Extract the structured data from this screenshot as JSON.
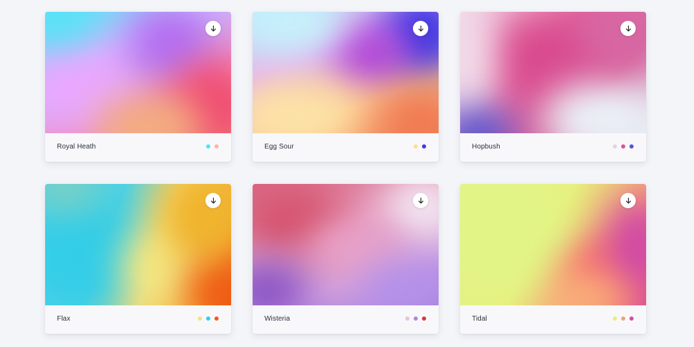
{
  "cards": [
    {
      "name": "Royal Heath",
      "swatches": [
        "#4fe3ef",
        "#f7b7a3"
      ],
      "preview": {
        "base": "linear-gradient(155deg, #5fe6f6 0%, #c9b6ff 35%, #f08fc5 65%, #f4b07e 100%)",
        "blobs": [
          {
            "color": "#e9a8ff",
            "l": -30,
            "t": 40,
            "w": 170,
            "h": 130
          },
          {
            "color": "#b36ef0",
            "l": 120,
            "t": -10,
            "w": 120,
            "h": 110
          },
          {
            "color": "#f04b72",
            "l": 175,
            "t": 70,
            "w": 130,
            "h": 140
          },
          {
            "color": "#f3ad7e",
            "l": 70,
            "t": 120,
            "w": 160,
            "h": 90
          },
          {
            "color": "#59e2f7",
            "l": -40,
            "t": -40,
            "w": 120,
            "h": 90
          }
        ]
      }
    },
    {
      "name": "Egg Sour",
      "swatches": [
        "#ffe08a",
        "#4a37e0"
      ],
      "preview": {
        "base": "linear-gradient(160deg, #b9ecf8 0%, #e7b3f0 35%, #fdc58a 70%, #f08a60 100%)",
        "blobs": [
          {
            "color": "#3d36e2",
            "l": 185,
            "t": -30,
            "w": 120,
            "h": 120
          },
          {
            "color": "#b043d8",
            "l": 110,
            "t": 20,
            "w": 120,
            "h": 80
          },
          {
            "color": "#fce3a7",
            "l": -30,
            "t": 100,
            "w": 180,
            "h": 100
          },
          {
            "color": "#f07a52",
            "l": 180,
            "t": 110,
            "w": 120,
            "h": 100
          },
          {
            "color": "#c6f1fb",
            "l": -20,
            "t": -30,
            "w": 150,
            "h": 90
          }
        ]
      }
    },
    {
      "name": "Hopbush",
      "swatches": [
        "#e6d2e0",
        "#d7559b",
        "#5257cf"
      ],
      "preview": {
        "base": "linear-gradient(135deg, #f3d8e6 0%, #e4669f 40%, #d96a9f 70%, #dfe9f3 100%)",
        "blobs": [
          {
            "color": "#d94b8f",
            "l": 40,
            "t": 10,
            "w": 180,
            "h": 120
          },
          {
            "color": "#f1dcea",
            "l": -40,
            "t": -20,
            "w": 90,
            "h": 200
          },
          {
            "color": "#eaf0f6",
            "l": 120,
            "t": 100,
            "w": 170,
            "h": 110
          },
          {
            "color": "#4d52d1",
            "l": -30,
            "t": 140,
            "w": 110,
            "h": 70
          },
          {
            "color": "#d667a3",
            "l": 170,
            "t": -20,
            "w": 120,
            "h": 100
          }
        ]
      }
    },
    {
      "name": "Flax",
      "swatches": [
        "#f4e07f",
        "#33cfe6",
        "#f05a1c"
      ],
      "preview": {
        "base": "linear-gradient(110deg, #4fd4ea 0%, #4fd2e4 35%, #f6d873 60%, #f4ad3a 85%, #ed5a18 100%)",
        "blobs": [
          {
            "color": "#34cde8",
            "l": -40,
            "t": 20,
            "w": 180,
            "h": 160
          },
          {
            "color": "#f4e884",
            "l": 110,
            "t": 60,
            "w": 120,
            "h": 120
          },
          {
            "color": "#efb42c",
            "l": 170,
            "t": -20,
            "w": 120,
            "h": 130
          },
          {
            "color": "#ef5a12",
            "l": 200,
            "t": 110,
            "w": 100,
            "h": 90
          },
          {
            "color": "#7fcfc0",
            "l": -20,
            "t": -30,
            "w": 100,
            "h": 70
          }
        ]
      }
    },
    {
      "name": "Wisteria",
      "swatches": [
        "#e9c3d3",
        "#b780e6",
        "#cf3b45"
      ],
      "preview": {
        "base": "linear-gradient(160deg, #dc6a86 0%, #e6a1c1 40%, #cfa1e0 70%, #a780e2 100%)",
        "blobs": [
          {
            "color": "#d5546f",
            "l": -20,
            "t": 0,
            "w": 160,
            "h": 100
          },
          {
            "color": "#f3e9f4",
            "l": 190,
            "t": -10,
            "w": 110,
            "h": 90
          },
          {
            "color": "#e9a2c8",
            "l": 80,
            "t": 50,
            "w": 140,
            "h": 90
          },
          {
            "color": "#8a54c6",
            "l": -40,
            "t": 110,
            "w": 120,
            "h": 90
          },
          {
            "color": "#b491ea",
            "l": 150,
            "t": 110,
            "w": 140,
            "h": 80
          }
        ]
      }
    },
    {
      "name": "Tidal",
      "swatches": [
        "#e4ef7d",
        "#f2a276",
        "#d24f9d"
      ],
      "preview": {
        "base": "linear-gradient(120deg, #e3f48a 0%, #e7f07e 45%, #f6a07a 75%, #e04c98 100%)",
        "blobs": [
          {
            "color": "#e2f486",
            "l": -40,
            "t": -20,
            "w": 200,
            "h": 180
          },
          {
            "color": "#f86a6e",
            "l": 150,
            "t": 80,
            "w": 110,
            "h": 100
          },
          {
            "color": "#cf48a6",
            "l": 210,
            "t": 20,
            "w": 90,
            "h": 140
          },
          {
            "color": "#f9b37a",
            "l": 120,
            "t": 130,
            "w": 120,
            "h": 70
          }
        ]
      }
    }
  ]
}
